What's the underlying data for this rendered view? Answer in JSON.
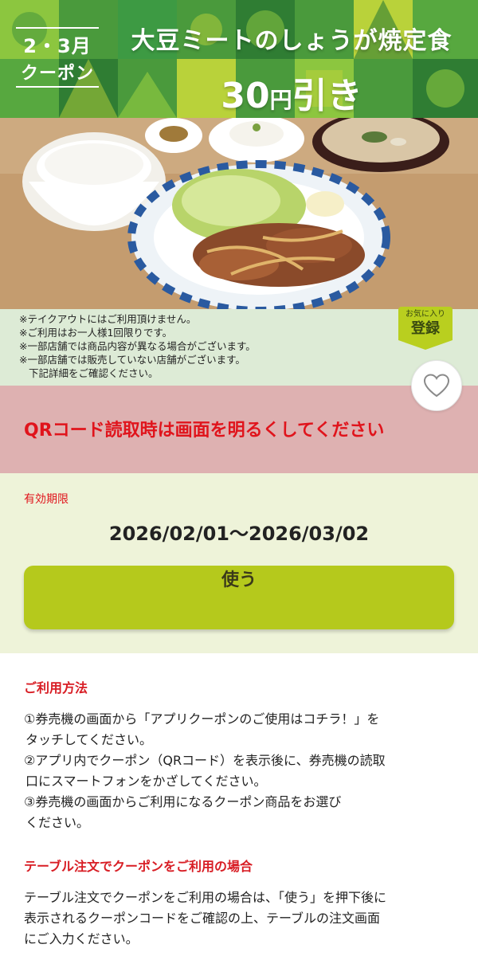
{
  "banner": {
    "period": "2・3月",
    "coupon_label": "クーポン",
    "title": "大豆ミートのしょうが焼定食",
    "discount_number": "30",
    "discount_yen": "円",
    "discount_suffix": "引き",
    "colors": {
      "green_dark": "#3f8f3a",
      "green_light": "#8cc63f",
      "yellow_green": "#b9d23a"
    }
  },
  "photo": {
    "icon": "food-photo"
  },
  "notes": [
    "※テイクアウトにはご利用頂けません。",
    "※ご利用はお一人様1回限りです。",
    "※一部店舗では商品内容が異なる場合がございます。",
    "※一部店舗では販売していない店舗がございます。",
    "下記詳細をご確認ください。"
  ],
  "favorite_tag": {
    "top": "お気に入り",
    "main": "登録"
  },
  "favorite_button": {
    "icon": "heart-icon"
  },
  "qr_notice": "QRコード読取時は画面を明るくしてください",
  "validity": {
    "label": "有効期限",
    "dates": "2026/02/01〜2026/03/02"
  },
  "use_button": "使う",
  "how_to_use": {
    "title": "ご利用方法",
    "lines": [
      "①券売機の画面から「アプリクーポンのご使用はコチラ！」を",
      "タッチしてください。",
      "②アプリ内でクーポン（QRコード）を表示後に、券売機の読取",
      "口にスマートフォンをかざしてください。",
      "③券売機の画面からご利用になるクーポン商品をお選び",
      "ください。"
    ]
  },
  "table_order": {
    "title": "テーブル注文でクーポンをご利用の場合",
    "lines": [
      "テーブル注文でクーポンをご利用の場合は、「使う」を押下後に",
      "表示されるクーポンコードをご確認の上、テーブルの注文画面",
      "にご入力ください。"
    ]
  },
  "colors": {
    "red": "#e0141c",
    "use_button": "#b5c91c",
    "qr_bg": "#deb1b1",
    "valid_bg": "#eef3d9",
    "notes_bg": "#ddebd6"
  }
}
